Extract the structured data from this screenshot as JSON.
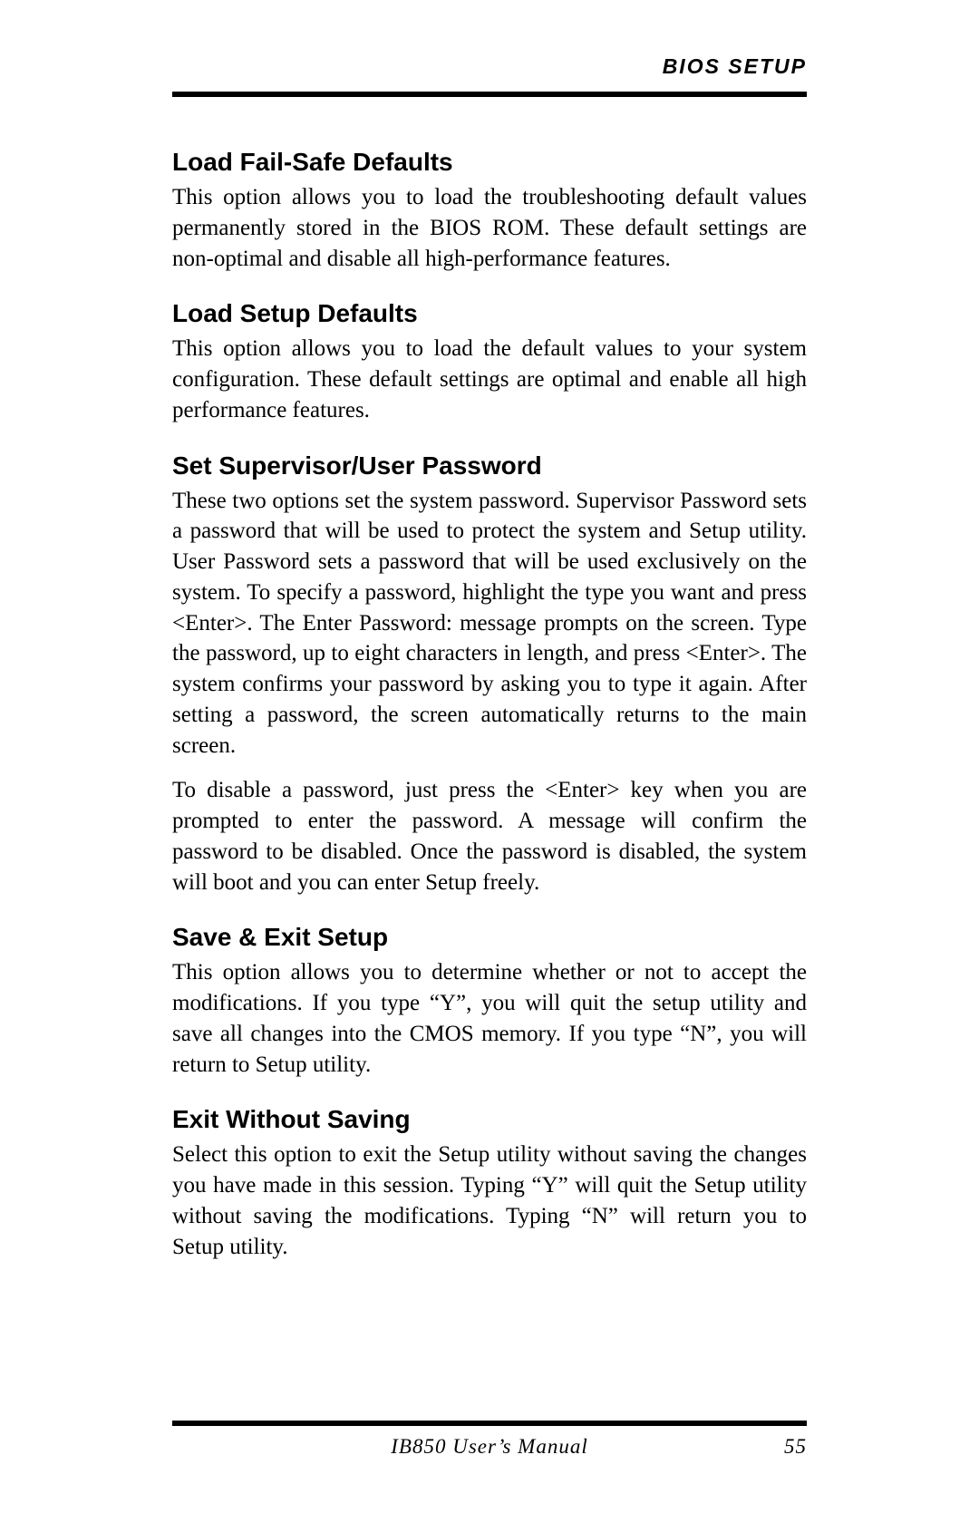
{
  "header": {
    "section_title": "BIOS SETUP"
  },
  "sections": [
    {
      "heading": "Load Fail-Safe Defaults",
      "paragraphs": [
        "This option allows you to load the troubleshooting default values permanently stored in the BIOS ROM. These default settings are non-optimal and disable all high-performance features."
      ]
    },
    {
      "heading": "Load Setup Defaults",
      "paragraphs": [
        "This option allows you to load the default values to your system configuration. These default settings are optimal and enable all high performance features."
      ]
    },
    {
      "heading": "Set Supervisor/User Password",
      "paragraphs": [
        "These two options set the system password. Supervisor Password sets a password that will be used to protect the system and Setup utility. User Password sets a password that will be used exclusively on the system. To specify a password, highlight the type you want and press <Enter>. The Enter Password: message prompts on the screen. Type the password, up to eight characters in length, and press <Enter>. The system confirms your password by asking you to type it again. After setting a password, the screen automatically returns to the main screen.",
        "To disable a password, just press the <Enter> key when you are prompted to enter the password. A message will confirm the password to be disabled. Once the password is disabled, the system will boot and you can enter Setup freely."
      ]
    },
    {
      "heading": "Save & Exit Setup",
      "paragraphs": [
        "This option allows you to determine whether or not to accept the modifications. If you type “Y”, you will quit the setup utility and save all changes into the CMOS memory. If you type “N”, you will return to Setup utility."
      ]
    },
    {
      "heading": "Exit Without Saving",
      "paragraphs": [
        "Select this option to exit the Setup utility without saving the changes you have made in this session. Typing “Y” will quit the Setup utility without saving the modifications. Typing “N” will return you to Setup utility."
      ]
    }
  ],
  "footer": {
    "manual_title": "IB850 User’s Manual",
    "page_number": "55"
  }
}
